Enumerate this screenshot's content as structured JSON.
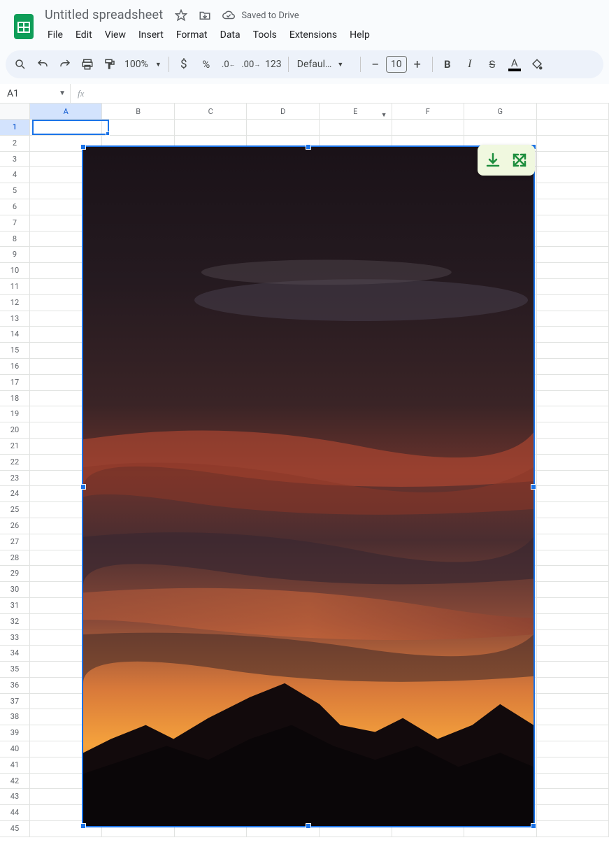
{
  "header": {
    "doc_title": "Untitled spreadsheet",
    "saved_status": "Saved to Drive"
  },
  "menu": {
    "items": [
      "File",
      "Edit",
      "View",
      "Insert",
      "Format",
      "Data",
      "Tools",
      "Extensions",
      "Help"
    ]
  },
  "toolbar": {
    "zoom": "100%",
    "number_format": "123",
    "font": "Defaul…",
    "font_size": "10"
  },
  "namebox": {
    "ref": "A1"
  },
  "grid": {
    "columns": [
      "A",
      "B",
      "C",
      "D",
      "E",
      "F",
      "G",
      ""
    ],
    "selected_col": "A",
    "filter_col": "E",
    "row_count": 45,
    "selected_row": 1
  }
}
